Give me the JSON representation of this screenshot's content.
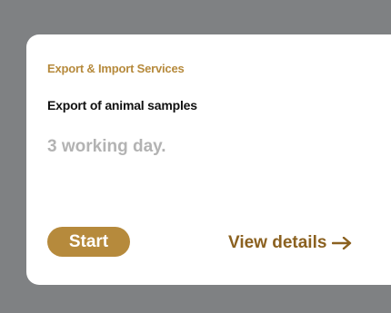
{
  "card": {
    "category": "Export & Import Services",
    "title": "Export of animal samples",
    "duration": "3 working day.",
    "start_label": "Start",
    "details_label": "View details",
    "details_icon": "arrow-right-icon"
  },
  "colors": {
    "background": "#7f8183",
    "card": "#ffffff",
    "accent_gold": "#b68a3c",
    "details_brown": "#8b6120",
    "duration_gray": "#b3b3b3"
  }
}
